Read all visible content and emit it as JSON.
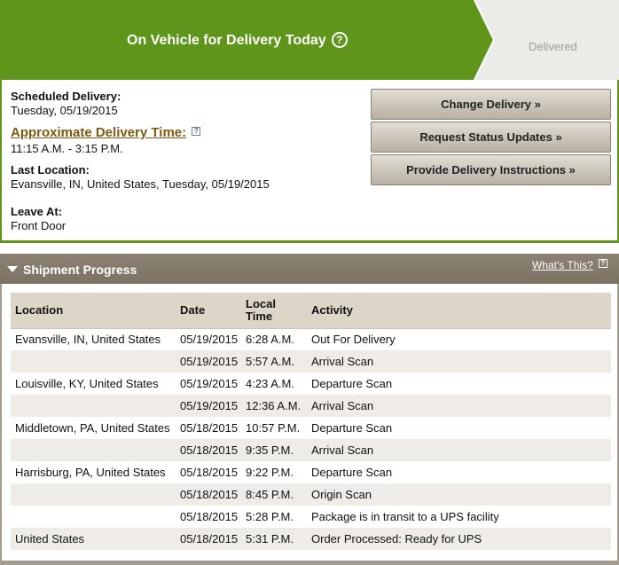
{
  "banner": {
    "status_title": "On Vehicle for Delivery Today",
    "help_symbol": "?",
    "next_step": "Delivered",
    "colors": {
      "green": "#5e951a",
      "gray": "#ebebe7"
    }
  },
  "details": {
    "scheduled_label": "Scheduled Delivery:",
    "scheduled_value": "Tuesday, 05/19/2015",
    "approx_label": "Approximate Delivery Time:",
    "approx_help": "?",
    "approx_value": "11:15 A.M. - 3:15 P.M.",
    "last_location_label": "Last Location:",
    "last_location_value": "Evansville, IN, United States, Tuesday, 05/19/2015",
    "leave_at_label": "Leave At:",
    "leave_at_value": "Front Door"
  },
  "actions": {
    "change_delivery": "Change Delivery »",
    "request_status": "Request Status Updates »",
    "provide_instructions": "Provide Delivery Instructions »"
  },
  "progress": {
    "title": "Shipment Progress",
    "whats_this": "What's This?",
    "help_symbol": "?",
    "columns": {
      "location": "Location",
      "date": "Date",
      "time": "Local Time",
      "activity": "Activity"
    },
    "rows": [
      {
        "location": "Evansville, IN, United States",
        "date": "05/19/2015",
        "time": "6:28 A.M.",
        "activity": "Out For Delivery"
      },
      {
        "location": "",
        "date": "05/19/2015",
        "time": "5:57 A.M.",
        "activity": "Arrival Scan"
      },
      {
        "location": "Louisville, KY, United States",
        "date": "05/19/2015",
        "time": "4:23 A.M.",
        "activity": "Departure Scan"
      },
      {
        "location": "",
        "date": "05/19/2015",
        "time": "12:36 A.M.",
        "activity": "Arrival Scan"
      },
      {
        "location": "Middletown, PA, United States",
        "date": "05/18/2015",
        "time": "10:57 P.M.",
        "activity": "Departure Scan"
      },
      {
        "location": "",
        "date": "05/18/2015",
        "time": "9:35 P.M.",
        "activity": "Arrival Scan"
      },
      {
        "location": "Harrisburg, PA, United States",
        "date": "05/18/2015",
        "time": "9:22 P.M.",
        "activity": "Departure Scan"
      },
      {
        "location": "",
        "date": "05/18/2015",
        "time": "8:45 P.M.",
        "activity": "Origin Scan"
      },
      {
        "location": "",
        "date": "05/18/2015",
        "time": "5:28 P.M.",
        "activity": "Package is in transit to a UPS facility"
      },
      {
        "location": "United States",
        "date": "05/18/2015",
        "time": "5:31 P.M.",
        "activity": "Order Processed: Ready for UPS"
      }
    ]
  }
}
